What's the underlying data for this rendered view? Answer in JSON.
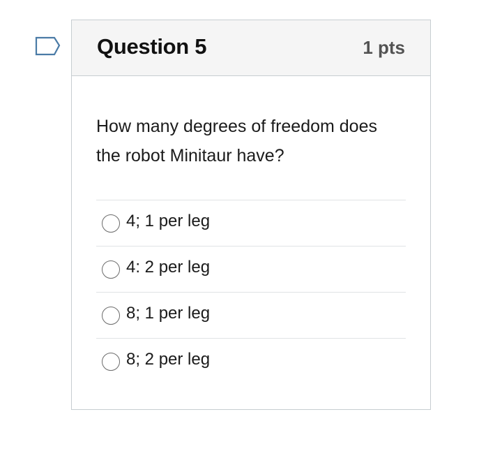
{
  "question": {
    "title": "Question 5",
    "points": "1 pts",
    "text": "How many degrees of freedom does the robot Minitaur have?",
    "flag_icon": "bookmark-flag-icon"
  },
  "answers": [
    {
      "label": "4; 1 per leg",
      "selected": false
    },
    {
      "label": "4: 2 per leg",
      "selected": false
    },
    {
      "label": "8; 1 per leg",
      "selected": false
    },
    {
      "label": "8; 2 per leg",
      "selected": false
    }
  ],
  "colors": {
    "flag_stroke": "#4a7ba6",
    "header_bg": "#f5f5f5",
    "border": "#c7cdd1"
  }
}
